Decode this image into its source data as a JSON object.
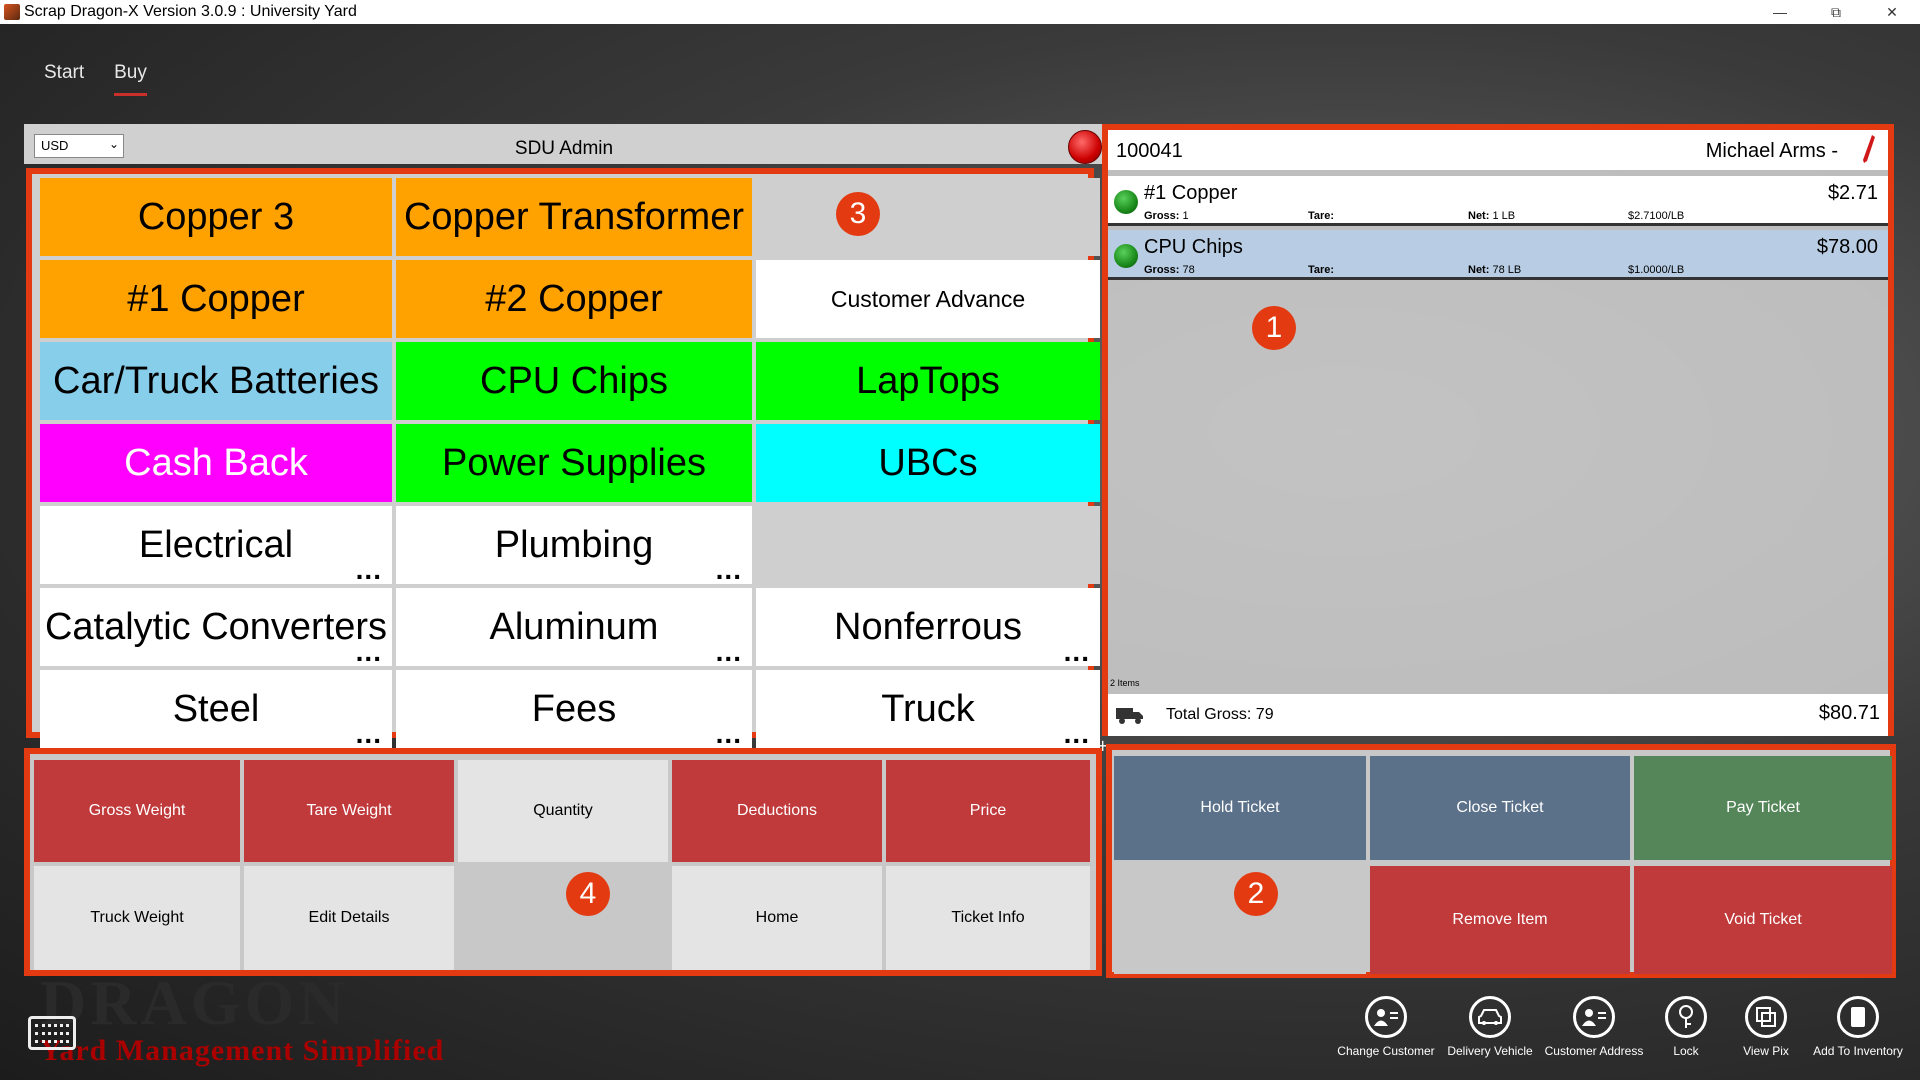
{
  "window": {
    "title": "Scrap Dragon-X  Version 3.0.9 : University Yard",
    "minimize": "—",
    "restore": "⧉",
    "close": "✕"
  },
  "nav": {
    "items": [
      {
        "label": "Start"
      },
      {
        "label": "Buy"
      }
    ]
  },
  "header": {
    "currency": "USD",
    "admin": "SDU Admin"
  },
  "products": {
    "items": [
      {
        "label": "Copper 3"
      },
      {
        "label": "Copper Transformer"
      },
      {
        "label": ""
      },
      {
        "label": "#1 Copper"
      },
      {
        "label": "#2 Copper"
      },
      {
        "label": "Customer Advance"
      },
      {
        "label": "Car/Truck Batteries"
      },
      {
        "label": "CPU Chips"
      },
      {
        "label": "LapTops"
      },
      {
        "label": "Cash Back"
      },
      {
        "label": "Power Supplies"
      },
      {
        "label": "UBCs"
      },
      {
        "label": "Electrical"
      },
      {
        "label": "Plumbing"
      },
      {
        "label": ""
      },
      {
        "label": "Catalytic Converters"
      },
      {
        "label": "Aluminum"
      },
      {
        "label": "Nonferrous"
      },
      {
        "label": "Steel"
      },
      {
        "label": "Fees"
      },
      {
        "label": "Truck"
      }
    ],
    "more": "..."
  },
  "callouts": {
    "one": "1",
    "two": "2",
    "three": "3",
    "four": "4"
  },
  "ticket": {
    "number": "100041",
    "customer": "Michael Arms  -",
    "lines": [
      {
        "name": "#1 Copper",
        "price": "$2.71",
        "gross_label": "Gross:",
        "gross": "1",
        "tare_label": "Tare:",
        "net_label": "Net:",
        "net": "1 LB",
        "rate": "$2.7100/LB"
      },
      {
        "name": "CPU Chips",
        "price": "$78.00",
        "gross_label": "Gross:",
        "gross": "78",
        "tare_label": "Tare:",
        "net_label": "Net:",
        "net": "78 LB",
        "rate": "$1.0000/LB"
      }
    ],
    "items_count": "2  Items",
    "total_gross": "Total Gross: 79",
    "total": "$80.71"
  },
  "functions": {
    "gross_weight": "Gross Weight",
    "tare_weight": "Tare Weight",
    "quantity": "Quantity",
    "deductions": "Deductions",
    "price": "Price",
    "truck_weight": "Truck Weight",
    "edit_details": "Edit Details",
    "home": "Home",
    "ticket_info": "Ticket Info"
  },
  "actions": {
    "hold": "Hold Ticket",
    "close": "Close Ticket",
    "pay": "Pay Ticket",
    "remove": "Remove Item",
    "void": "Void Ticket"
  },
  "brand": {
    "big": "DRAGON",
    "tagline": "Yard Management Simplified"
  },
  "toolbar": {
    "items": [
      {
        "label": "Change Customer",
        "icon": "person-card-icon"
      },
      {
        "label": "Delivery Vehicle",
        "icon": "car-icon"
      },
      {
        "label": "Customer Address",
        "icon": "address-card-icon"
      },
      {
        "label": "Lock",
        "icon": "key-icon"
      },
      {
        "label": "View Pix",
        "icon": "pictures-icon"
      },
      {
        "label": "Add To Inventory",
        "icon": "inventory-icon"
      }
    ]
  },
  "colors": {
    "accent_frame": "#e43a12",
    "orange": "#ffa200",
    "green": "#00ff00",
    "magenta": "#ff00ff",
    "cyan": "#00ffff",
    "sky": "#87ceeb",
    "red_button": "#c0393b",
    "slate_button": "#5b7089",
    "pay_green": "#55865a"
  }
}
